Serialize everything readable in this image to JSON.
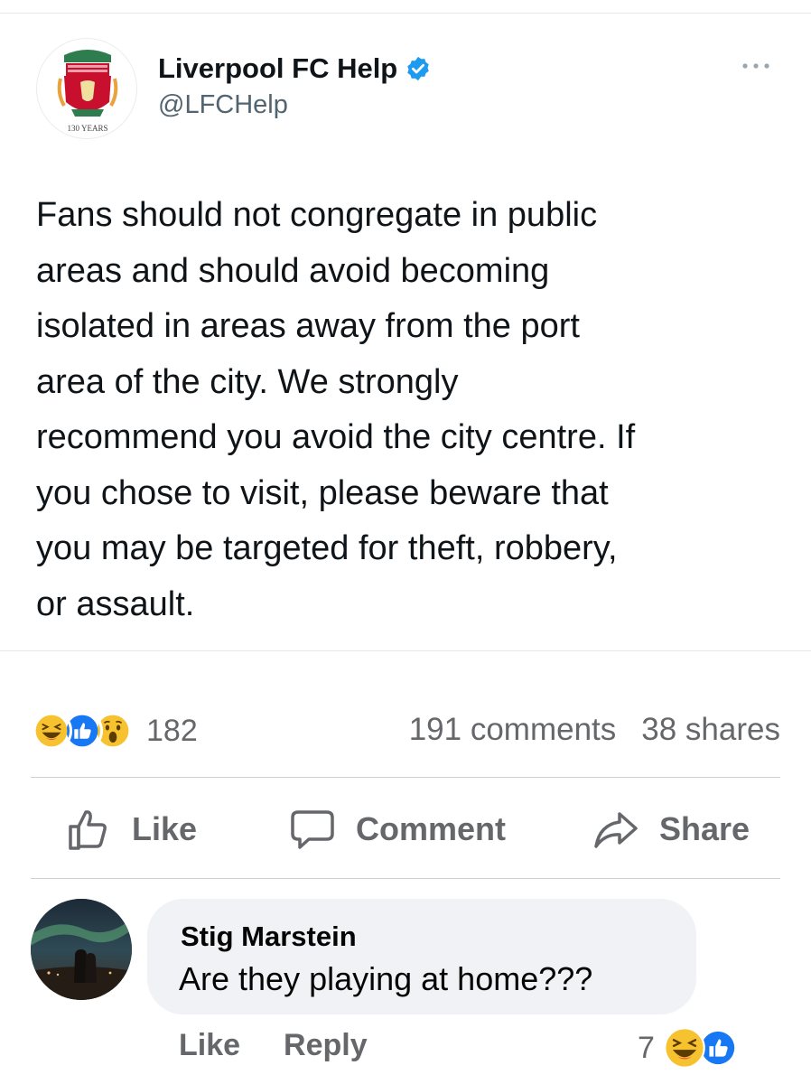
{
  "tweet": {
    "name": "Liverpool FC Help",
    "handle": "@LFCHelp",
    "avatar_text": "130 YEARS",
    "body": "Fans should not congregate in public\nareas and should avoid becoming\nisolated in areas away from the port\narea of the city. We strongly\nrecommend you avoid the city centre. If\nyou chose to visit, please beware that\nyou may be targeted for theft, robbery,\nor assault.",
    "verified_color": "#1d9bf0"
  },
  "post": {
    "reaction_icons": [
      "haha-icon",
      "like-icon",
      "wow-icon"
    ],
    "reaction_count": "182",
    "comments": "191 comments",
    "shares": "38 shares"
  },
  "actions": {
    "like": "Like",
    "comment": "Comment",
    "share": "Share"
  },
  "comment": {
    "author": "Stig Marstein",
    "text": "Are they playing at home???",
    "like": "Like",
    "reply": "Reply",
    "reaction_count": "7",
    "reaction_icons": [
      "haha-icon",
      "like-icon"
    ]
  },
  "colors": {
    "like_blue": "#1877f2",
    "emoji_yellow": "#f7c22f",
    "muted_text": "#65676b",
    "bubble_bg": "#f0f2f5"
  }
}
